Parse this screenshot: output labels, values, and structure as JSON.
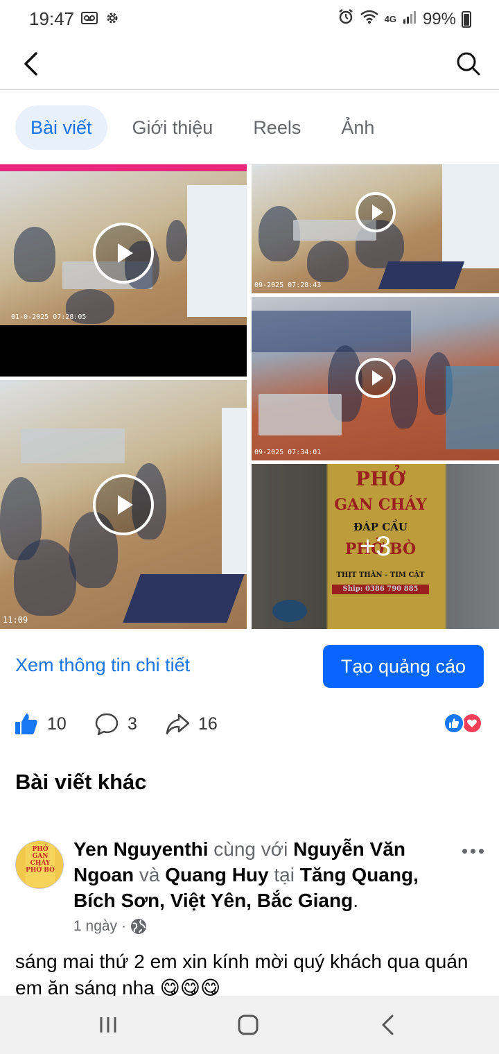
{
  "status_bar": {
    "time": "19:47",
    "network": "4G",
    "battery": "99%",
    "icons": [
      "voicemail-icon",
      "settings-icon",
      "alarm-icon",
      "wifi-icon",
      "signal-icon",
      "battery-icon"
    ]
  },
  "nav": {
    "back_icon": "chevron-left-icon",
    "search_icon": "search-icon"
  },
  "tabs": [
    {
      "label": "Bài viết",
      "active": true
    },
    {
      "label": "Giới thiệu",
      "active": false
    },
    {
      "label": "Reels",
      "active": false
    },
    {
      "label": "Ảnh",
      "active": false
    }
  ],
  "media": {
    "timestamps": [
      "01-0-2025 07:28:05",
      "09-2025 07:28:43",
      "09-2025 07:34:01",
      "11:09"
    ],
    "more_count": "+3",
    "sign_lines": [
      "PHỞ",
      "GAN CHÁY",
      "ĐÁP CẦU",
      "PHỞ BÒ",
      "THỊT THĂN - TIM CẬT",
      "Ship: 0386 790 885"
    ]
  },
  "actions": {
    "detail_link": "Xem thông tin chi tiết",
    "ad_button": "Tạo quảng cáo"
  },
  "reactions": {
    "likes": "10",
    "comments": "3",
    "shares": "16",
    "colors": {
      "like": "#1877f2",
      "love": "#f33e58",
      "accent": "#0866ff"
    }
  },
  "section_title": "Bài viết khác",
  "post": {
    "author": "Yen Nguyenthi",
    "with_word": "cùng với",
    "tagged_1": "Nguyễn Văn Ngoan",
    "and_word": "và",
    "tagged_2": "Quang Huy",
    "at_word": "tại",
    "location": "Tăng Quang, Bích Sơn, Việt Yên, Bắc Giang",
    "time": "1 ngày",
    "separator": "·",
    "text": "sáng mai thứ 2  em xin kính mời quý khách qua quán em ăn sáng nha 😋😋😋"
  }
}
